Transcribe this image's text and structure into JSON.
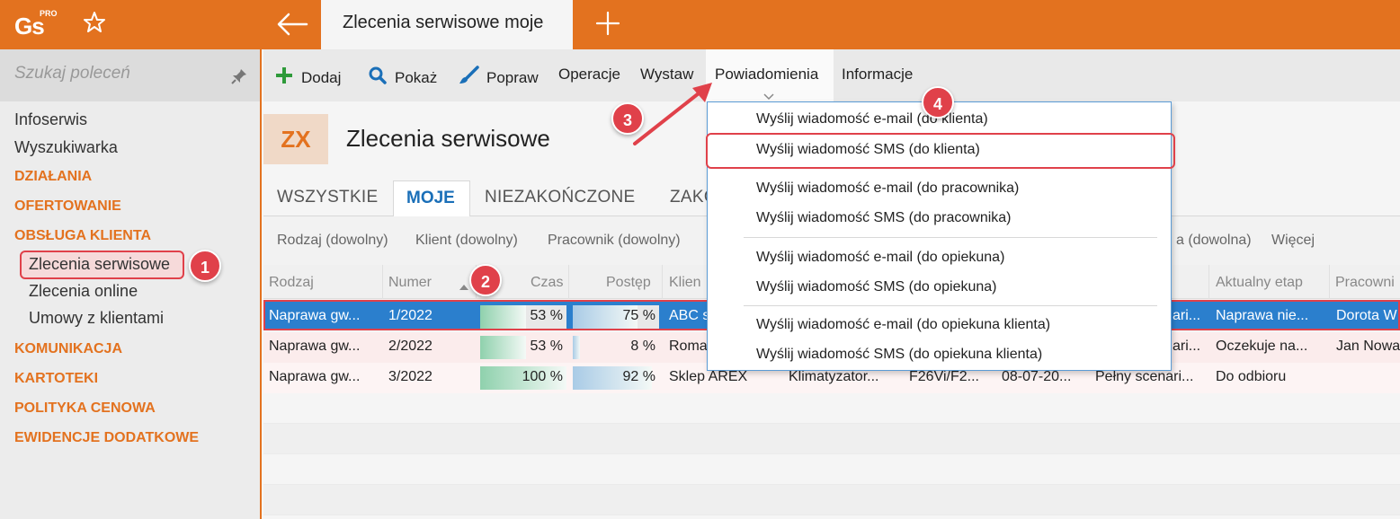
{
  "header": {
    "logo_text": "Gs",
    "logo_superscript": "PRO",
    "tab_title": "Zlecenia serwisowe moje"
  },
  "sidebar": {
    "search_placeholder": "Szukaj poleceń",
    "items": [
      {
        "label": "Infoserwis",
        "kind": "item"
      },
      {
        "label": "Wyszukiwarka",
        "kind": "item"
      },
      {
        "label": "DZIAŁANIA",
        "kind": "category"
      },
      {
        "label": "OFERTOWANIE",
        "kind": "category"
      },
      {
        "label": "OBSŁUGA KLIENTA",
        "kind": "category"
      },
      {
        "label": "Zlecenia serwisowe",
        "kind": "sub",
        "selected": true
      },
      {
        "label": "Zlecenia online",
        "kind": "sub"
      },
      {
        "label": "Umowy z klientami",
        "kind": "sub"
      },
      {
        "label": "KOMUNIKACJA",
        "kind": "category"
      },
      {
        "label": "KARTOTEKI",
        "kind": "category"
      },
      {
        "label": "POLITYKA CENOWA",
        "kind": "category"
      },
      {
        "label": "EWIDENCJE DODATKOWE",
        "kind": "category"
      }
    ]
  },
  "toolbar": {
    "add": "Dodaj",
    "show": "Pokaż",
    "edit": "Popraw",
    "operations": "Operacje",
    "issue": "Wystaw",
    "notifications": "Powiadomienia",
    "info": "Informacje"
  },
  "page": {
    "badge": "ZX",
    "title": "Zlecenia serwisowe"
  },
  "view_tabs": [
    "WSZYSTKIE",
    "MOJE",
    "NIEZAKOŃCZONE",
    "ZAKO"
  ],
  "filters": [
    "Rodzaj (dowolny)",
    "Klient (dowolny)",
    "Pracownik (dowolny)",
    "a (dowolna)",
    "Więcej"
  ],
  "grid": {
    "headers": [
      "Rodzaj",
      "Numer",
      "Czas",
      "Postęp",
      "Klien",
      "Aktualny etap",
      "Pracowni"
    ],
    "rows": [
      {
        "rodzaj": "Naprawa gw...",
        "numer": "1/2022",
        "czas": "53 %",
        "czas_pct": 0.53,
        "postep": "75 %",
        "postep_pct": 0.75,
        "klient": "ABC s",
        "urzadzenie": "",
        "model": "",
        "data": "",
        "scenariusz": "ari...",
        "etap": "Naprawa nie...",
        "pracownik": "Dorota W"
      },
      {
        "rodzaj": "Naprawa gw...",
        "numer": "2/2022",
        "czas": "53 %",
        "czas_pct": 0.53,
        "postep": "8 %",
        "postep_pct": 0.08,
        "klient": "Roma",
        "urzadzenie": "",
        "model": "",
        "data": "",
        "scenariusz": "ari...",
        "etap": "Oczekuje na...",
        "pracownik": "Jan Nowa"
      },
      {
        "rodzaj": "Naprawa gw...",
        "numer": "3/2022",
        "czas": "100 %",
        "czas_pct": 1.0,
        "postep": "92 %",
        "postep_pct": 0.92,
        "klient": "Sklep AREX",
        "urzadzenie": "Klimatyzator...",
        "model": "F26Vi/F2...",
        "data": "08-07-20...",
        "scenariusz": "Pełny scenari...",
        "etap": "Do odbioru",
        "pracownik": ""
      }
    ]
  },
  "dropdown": {
    "groups": [
      [
        "Wyślij wiadomość e-mail (do klienta)",
        "Wyślij wiadomość SMS (do klienta)"
      ],
      [
        "Wyślij wiadomość e-mail (do pracownika)",
        "Wyślij wiadomość SMS (do pracownika)"
      ],
      [
        "Wyślij wiadomość e-mail (do opiekuna)",
        "Wyślij wiadomość SMS (do opiekuna)"
      ],
      [
        "Wyślij wiadomość e-mail (do opiekuna klienta)",
        "Wyślij wiadomość SMS (do opiekuna klienta)"
      ]
    ]
  },
  "annotations": [
    "1",
    "2",
    "3",
    "4"
  ],
  "colors": {
    "accent": "#e3721f",
    "selection": "#2b7fcd",
    "highlight": "#e0414a",
    "time_bar": "#8fd1ad",
    "progress_bar": "#a9cbe6"
  }
}
